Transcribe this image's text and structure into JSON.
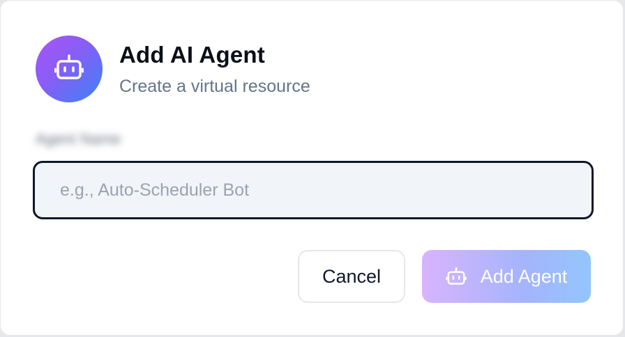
{
  "dialog": {
    "title": "Add AI Agent",
    "subtitle": "Create a virtual resource",
    "avatar_icon": "bot-icon"
  },
  "form": {
    "agent_name_label": "Agent Name",
    "agent_name_value": "",
    "agent_name_placeholder": "e.g., Auto-Scheduler Bot"
  },
  "actions": {
    "cancel_label": "Cancel",
    "submit_label": "Add Agent",
    "submit_icon": "bot-icon",
    "submit_disabled": true
  },
  "colors": {
    "accent_gradient_start": "#a855f7",
    "accent_gradient_end": "#3b82f6",
    "input_border": "#0f172a",
    "input_background": "#f1f4f9"
  }
}
